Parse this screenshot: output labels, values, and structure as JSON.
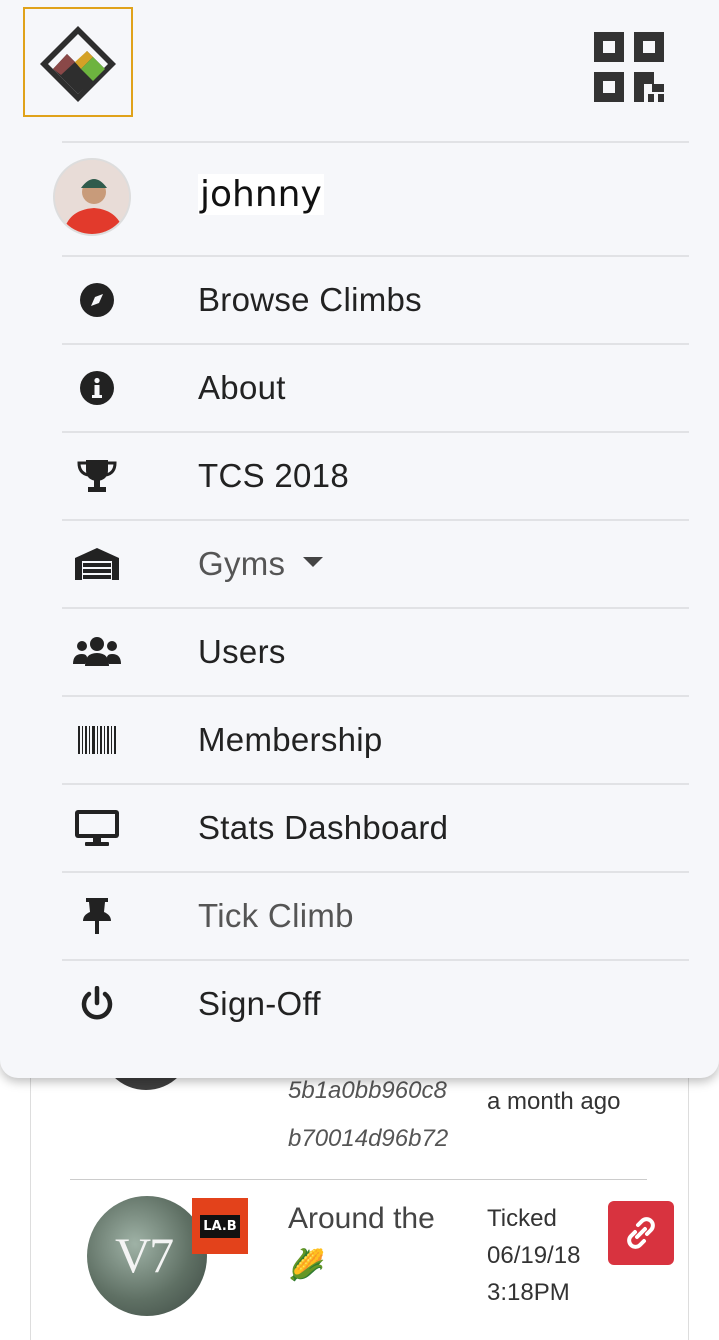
{
  "header": {
    "logo": "mountain-diamond-logo",
    "qr_icon": "qr-code-icon"
  },
  "user": {
    "name": "johnny"
  },
  "menu": {
    "items": [
      {
        "label": "Browse Climbs",
        "icon": "compass-icon"
      },
      {
        "label": "About",
        "icon": "info-icon"
      },
      {
        "label": "TCS 2018",
        "icon": "trophy-icon"
      },
      {
        "label": "Gyms",
        "icon": "warehouse-icon"
      },
      {
        "label": "Users",
        "icon": "users-icon"
      },
      {
        "label": "Membership",
        "icon": "barcode-icon"
      },
      {
        "label": "Stats Dashboard",
        "icon": "desktop-icon"
      },
      {
        "label": "Tick Climb",
        "icon": "pin-icon"
      },
      {
        "label": "Sign-Off",
        "icon": "power-icon"
      }
    ]
  },
  "background": {
    "id_line1": "5b1a0bb960c8",
    "id_line2": "b70014d96b72",
    "time_ago": "a month ago",
    "climb_grade": "V7",
    "gym_badge": "LA.B",
    "climb_name": "Around the",
    "climb_emoji": "🌽",
    "ticked_label": "Ticked",
    "ticked_date": "06/19/18",
    "ticked_time": "3:18PM"
  },
  "colors": {
    "menu_bg": "#f6f7fa",
    "logo_border": "#e0a21a",
    "unlink_button": "#d8333f",
    "badge": "#e3421b"
  }
}
